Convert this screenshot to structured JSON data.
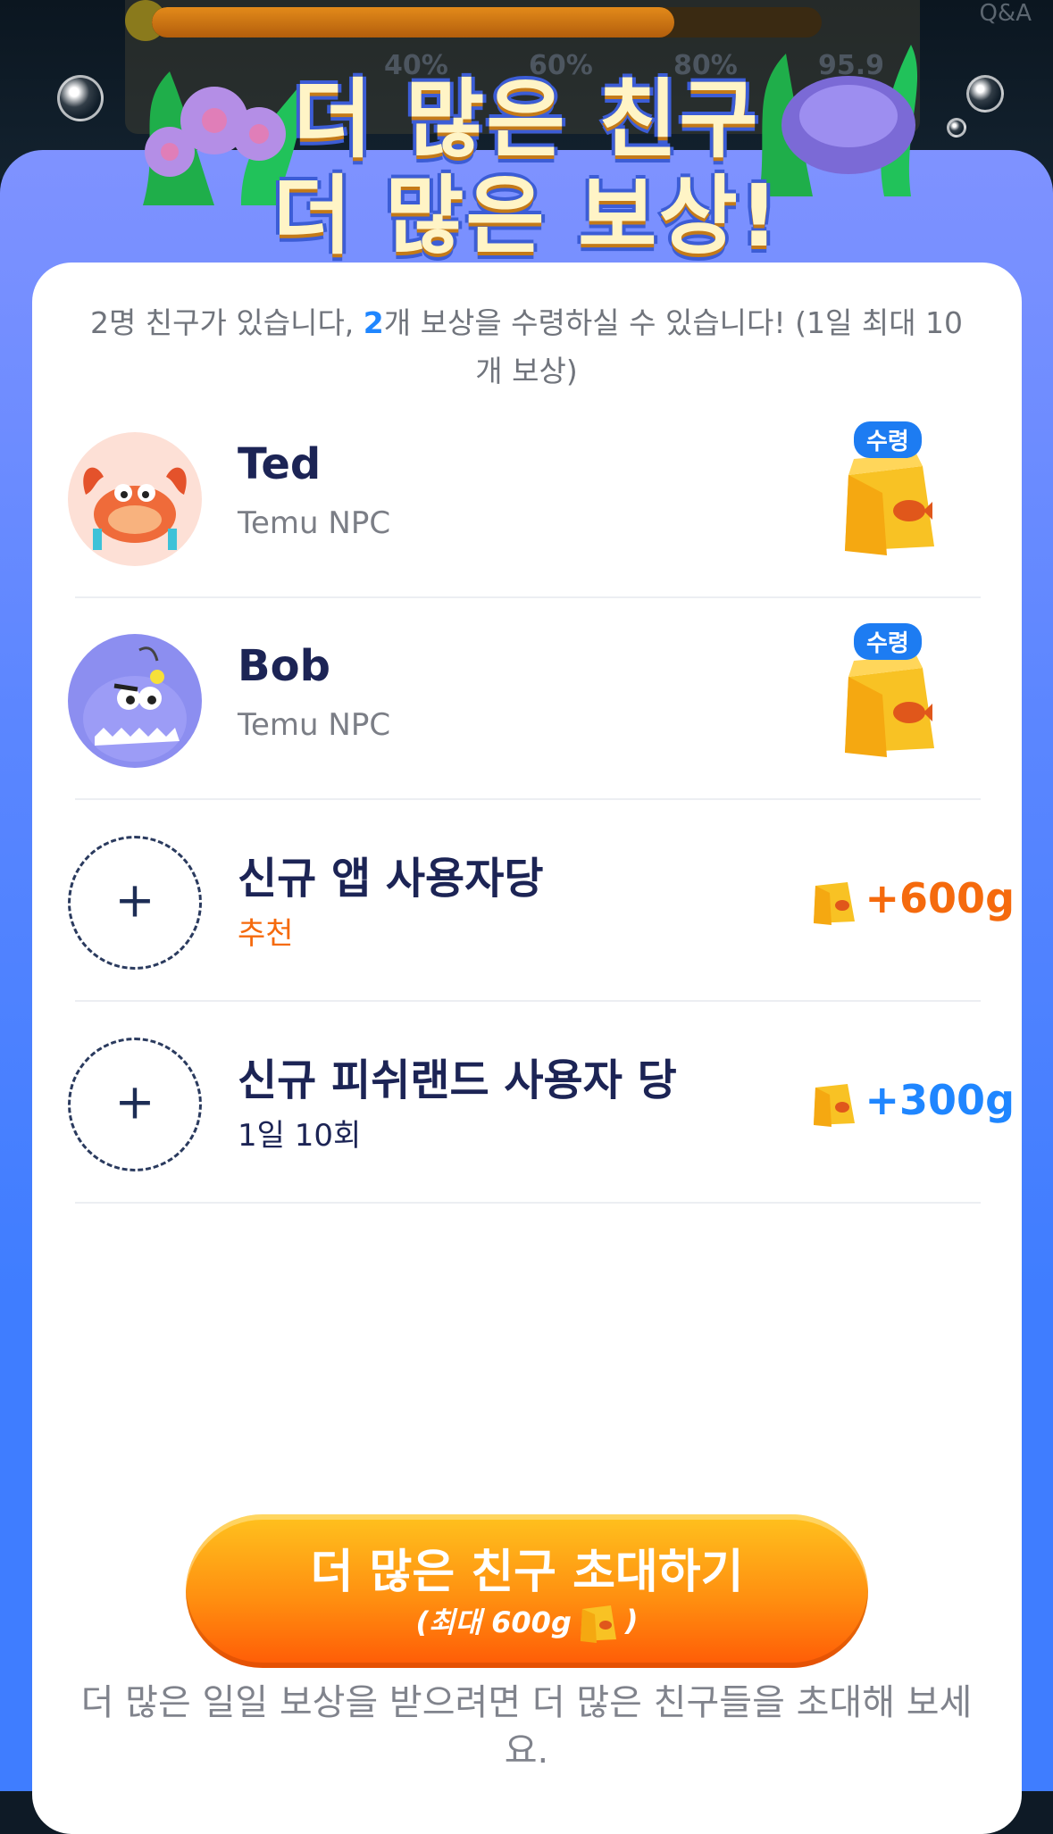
{
  "background": {
    "progress_marks": [
      "40%",
      "60%",
      "80%",
      "95.9"
    ],
    "qa_label": "Q&A",
    "progress_fraction": 0.78
  },
  "header": {
    "title_line1": "더 많은 친구",
    "title_line2": "더 많은 보상!"
  },
  "summary": {
    "prefix": "2명 친구가 있습니다, ",
    "count": "2",
    "suffix": "개 보상을 수령하실 수 있습니다! (1일 최대 10개 보상)"
  },
  "friends": [
    {
      "name": "Ted",
      "subtitle": "Temu NPC",
      "badge": "수령",
      "avatar_icon": "crab-avatar-icon"
    },
    {
      "name": "Bob",
      "subtitle": "Temu NPC",
      "badge": "수령",
      "avatar_icon": "fish-avatar-icon"
    }
  ],
  "invites": [
    {
      "title": "신규 앱 사용자당",
      "subtitle": "추천",
      "reward": "+600g",
      "color": "#f56a0d"
    },
    {
      "title": "신규 피쉬랜드 사용자 당",
      "subtitle": "1일 10회",
      "reward": "+300g",
      "color": "#1f86ff"
    }
  ],
  "cta": {
    "label": "더 많은 친구 초대하기",
    "sub_prefix": "(최대 600g",
    "sub_suffix": ")"
  },
  "footer": "더 많은 일일 보상을 받으려면 더 많은 친구들을 초대해 보세요.",
  "colors": {
    "accent_blue": "#1f86ff",
    "accent_orange": "#f56a0d",
    "sheet_blue": "#3f7dff"
  }
}
